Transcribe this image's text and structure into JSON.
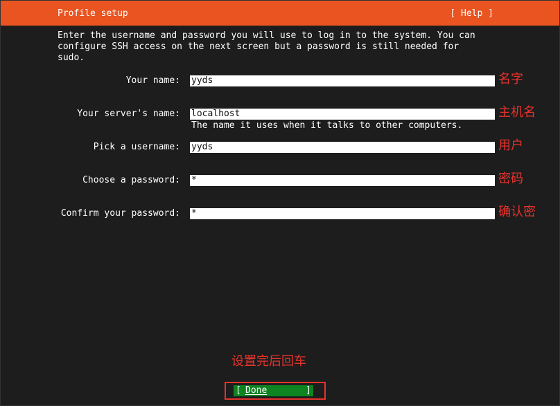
{
  "header": {
    "title": "Profile setup",
    "help_label": "[ Help ]"
  },
  "intro_text": "Enter the username and password you will use to log in to the system. You can\nconfigure SSH access on the next screen but a password is still needed for\nsudo.",
  "form": {
    "your_name": {
      "label": "Your name:",
      "value": "yyds",
      "annotation": "名字"
    },
    "server_name": {
      "label": "Your server's name:",
      "value": "localhost",
      "hint": "The name it uses when it talks to other computers.",
      "annotation": "主机名"
    },
    "username": {
      "label": "Pick a username:",
      "value": "yyds",
      "annotation": "用户"
    },
    "password": {
      "label": "Choose a password:",
      "value": "*",
      "annotation": "密码"
    },
    "confirm_password": {
      "label": "Confirm your password:",
      "value": "*",
      "annotation": "确认密"
    }
  },
  "done": {
    "annotation": "设置完后回车",
    "bracket_left": "[",
    "label": "Done",
    "bracket_right": "]"
  },
  "colors": {
    "header_bg": "#e95420",
    "background": "#1d1d1d",
    "done_bg": "#0e8420",
    "annotation": "#e8322c"
  }
}
